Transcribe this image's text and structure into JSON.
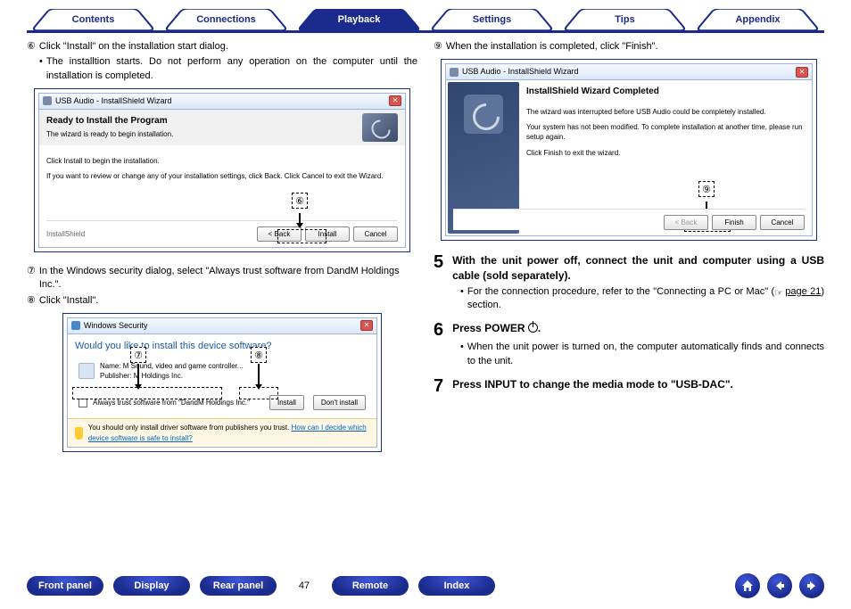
{
  "nav": {
    "tabs": [
      "Contents",
      "Connections",
      "Playback",
      "Settings",
      "Tips",
      "Appendix"
    ],
    "active": 2
  },
  "left": {
    "step6_marker": "⑥",
    "step6_text": "Click \"Install\" on the  installation start dialog.",
    "step6_bullet": "The installtion starts. Do not perform any operation on the computer until the installation is completed.",
    "ss1": {
      "title": "USB Audio - InstallShield Wizard",
      "heading": "Ready to Install the Program",
      "subheading": "The wizard is ready to begin installation.",
      "line1": "Click Install to begin the installation.",
      "line2": "If you want to review or change any of your installation settings, click Back. Click Cancel to exit the Wizard.",
      "footer_label": "InstallShield",
      "btn_back": "< Back",
      "btn_install": "Install",
      "btn_cancel": "Cancel",
      "callout": "⑥"
    },
    "step7_marker": "⑦",
    "step7_text": "In the Windows security dialog, select \"Always trust software from DandM Holdings Inc.\".",
    "step8_marker": "⑧",
    "step8_text": "Click \"Install\".",
    "ss2": {
      "title": "Windows Security",
      "question": "Would you like to install this device software?",
      "name_line": "Name: M           Sound, video and game controller...",
      "publisher_line": "Publisher:          M Holdings Inc.",
      "trust_line": "Always trust software from \"DandM Holdings Inc.\"",
      "btn_install": "Install",
      "btn_dont": "Don't install",
      "warn_line": "You should only install driver software from publishers you trust.",
      "warn_link": "How can I decide which device software is safe to install?",
      "callout7": "⑦",
      "callout8": "⑧"
    }
  },
  "right": {
    "step9_marker": "⑨",
    "step9_text": "When the installation is completed, click \"Finish\".",
    "ss3": {
      "title": "USB Audio - InstallShield Wizard",
      "heading": "InstallShield Wizard Completed",
      "line1": "The wizard was interrupted before USB Audio could be completely installed.",
      "line2": "Your system has not been modified. To complete installation at another time, please run setup again.",
      "line3": "Click Finish to exit the wizard.",
      "btn_back": "< Back",
      "btn_finish": "Finish",
      "btn_cancel": "Cancel",
      "callout": "⑨"
    },
    "big5_num": "5",
    "big5_text": "With the unit power off, connect the unit and computer using a USB cable (sold separately).",
    "big5_bullet_pre": "For the connection procedure, refer to the \"Connecting a PC or Mac\" (",
    "big5_bullet_link": "page 21",
    "big5_bullet_post": ") section.",
    "big6_num": "6",
    "big6_text": "Press POWER ",
    "big6_suffix": ".",
    "big6_bullet": "When the unit power is turned on, the computer automatically finds and connects to the unit.",
    "big7_num": "7",
    "big7_text": "Press INPUT to change the media mode to \"USB-DAC\"."
  },
  "footer": {
    "pills": [
      "Front panel",
      "Display",
      "Rear panel"
    ],
    "page": "47",
    "pills2": [
      "Remote",
      "Index"
    ]
  }
}
